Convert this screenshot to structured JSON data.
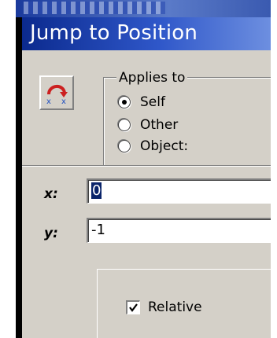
{
  "window": {
    "title": "Jump to Position"
  },
  "action_icon": {
    "name": "jump-to-position-icon"
  },
  "applies_to": {
    "legend": "Applies to",
    "options": [
      {
        "label": "Self",
        "checked": true
      },
      {
        "label": "Other",
        "checked": false
      },
      {
        "label": "Object:",
        "checked": false
      }
    ]
  },
  "fields": {
    "x": {
      "label": "x:",
      "value": "0"
    },
    "y": {
      "label": "y:",
      "value": "-1"
    }
  },
  "relative": {
    "label": "Relative",
    "checked": true
  },
  "colors": {
    "title_bar": "#0b2a8e",
    "dialog_bg": "#d4d0c8",
    "selection": "#0a246a"
  }
}
